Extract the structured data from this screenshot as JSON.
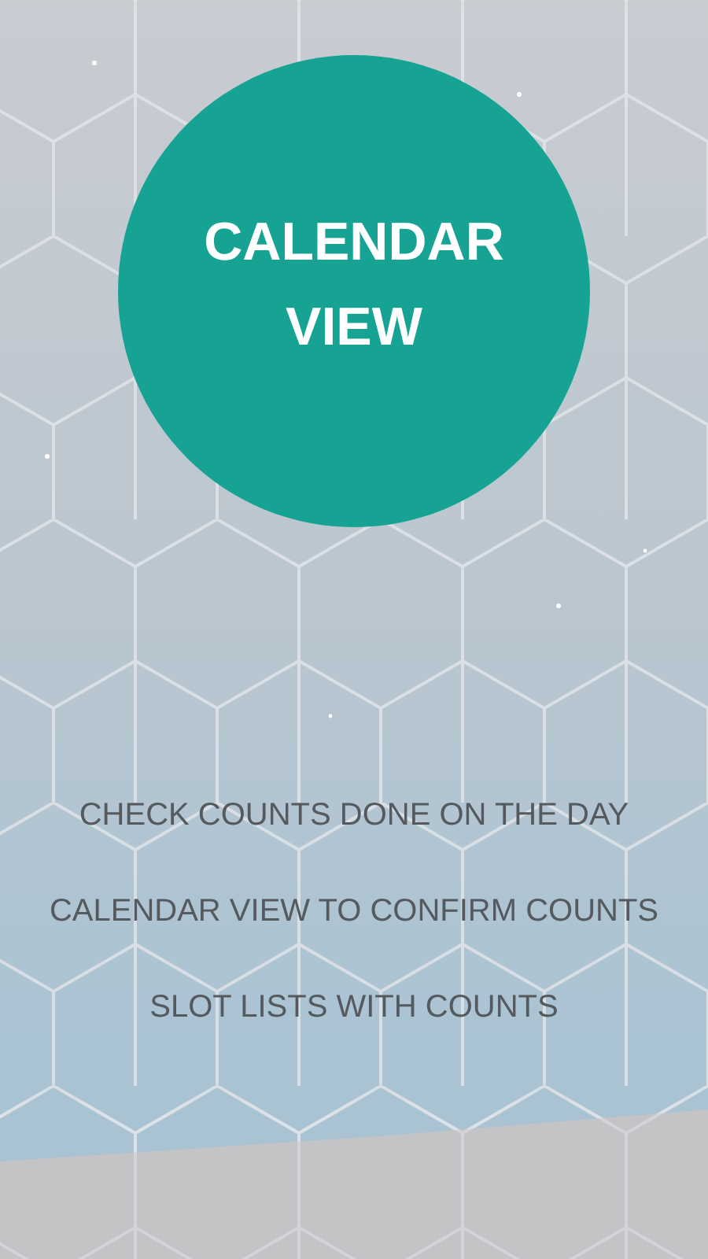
{
  "title": "CALENDAR VIEW",
  "features": [
    "CHECK COUNTS DONE ON THE DAY",
    "CALENDAR VIEW TO CONFIRM COUNTS",
    "SLOT LISTS WITH COUNTS"
  ]
}
